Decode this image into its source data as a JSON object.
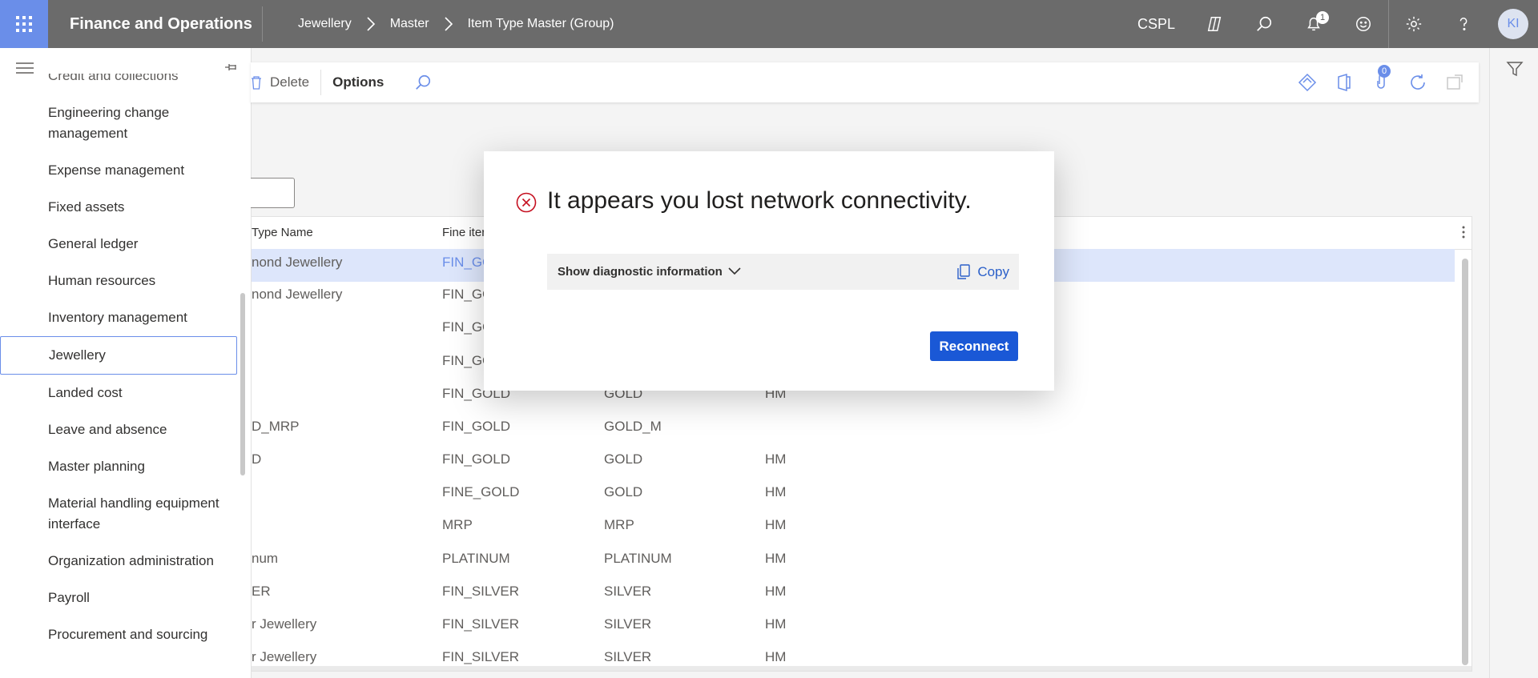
{
  "app": {
    "title": "Finance and Operations"
  },
  "breadcrumb": [
    "Jewellery",
    "Master",
    "Item Type Master (Group)"
  ],
  "topbar": {
    "company": "CSPL",
    "notification_count": "1",
    "avatar_initials": "KI",
    "icons": [
      "waffle-icon",
      "copilot-icon",
      "search-icon",
      "bell-icon",
      "smiley-icon",
      "gear-icon",
      "help-icon"
    ]
  },
  "sidebar": {
    "items": [
      "Credit and collections",
      "Engineering change management",
      "Expense management",
      "Fixed assets",
      "General ledger",
      "Human resources",
      "Inventory management",
      "Jewellery",
      "Landed cost",
      "Leave and absence",
      "Master planning",
      "Material handling equipment interface",
      "Organization administration",
      "Payroll",
      "Procurement and sourcing"
    ],
    "active": "Jewellery"
  },
  "actionbar": {
    "delete_label": "Delete",
    "options_label": "Options",
    "attach_count": "0"
  },
  "grid": {
    "columns": [
      "Type Name",
      "Fine iter"
    ],
    "rows": [
      [
        "nond Jewellery",
        "FIN_GC",
        "",
        ""
      ],
      [
        "nond Jewellery",
        "FIN_GC",
        "",
        ""
      ],
      [
        "",
        "FIN_GC",
        "",
        ""
      ],
      [
        "",
        "FIN_GC",
        "",
        ""
      ],
      [
        "",
        "FIN_GOLD",
        "GOLD",
        "HM"
      ],
      [
        "D_MRP",
        "FIN_GOLD",
        "GOLD_M",
        ""
      ],
      [
        "D",
        "FIN_GOLD",
        "GOLD",
        "HM"
      ],
      [
        "",
        "FINE_GOLD",
        "GOLD",
        "HM"
      ],
      [
        "",
        "MRP",
        "MRP",
        "HM"
      ],
      [
        "num",
        "PLATINUM",
        "PLATINUM",
        "HM"
      ],
      [
        "ER",
        "FIN_SILVER",
        "SILVER",
        "HM"
      ],
      [
        "r Jewellery",
        "FIN_SILVER",
        "SILVER",
        "HM"
      ],
      [
        "r Jewellery",
        "FIN_SILVER",
        "SILVER",
        "HM"
      ]
    ]
  },
  "dialog": {
    "title": "It appears you lost network connectivity.",
    "diagnostic_label": "Show diagnostic information",
    "copy_label": "Copy",
    "reconnect_label": "Reconnect"
  },
  "colors": {
    "topbar": "#6b6b6b",
    "accent": "#6a8ee9",
    "primary_button": "#1a58d6",
    "error": "#c50f1f"
  }
}
